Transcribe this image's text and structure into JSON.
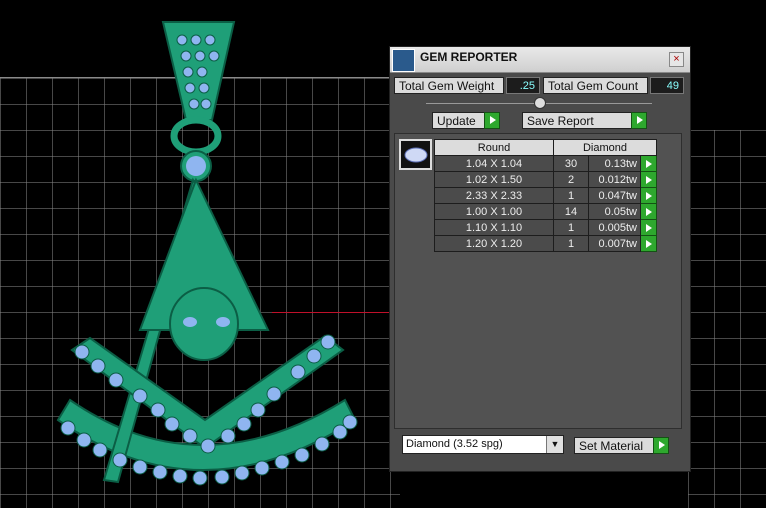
{
  "window": {
    "title": "GEM REPORTER",
    "close_glyph": "×"
  },
  "summary": {
    "weight_label": "Total Gem Weight",
    "weight_value": ".25",
    "count_label": "Total Gem Count",
    "count_value": "49"
  },
  "buttons": {
    "update": "Update",
    "save_report": "Save Report",
    "set_material": "Set Material"
  },
  "gem_table": {
    "headers": [
      "Round",
      "Diamond"
    ],
    "rows": [
      {
        "size": "1.04 X 1.04",
        "count": "30",
        "weight": "0.13tw"
      },
      {
        "size": "1.02 X 1.50",
        "count": "2",
        "weight": "0.012tw"
      },
      {
        "size": "2.33 X 2.33",
        "count": "1",
        "weight": "0.047tw"
      },
      {
        "size": "1.00 X 1.00",
        "count": "14",
        "weight": "0.05tw"
      },
      {
        "size": "1.10 X 1.10",
        "count": "1",
        "weight": "0.005tw"
      },
      {
        "size": "1.20 X 1.20",
        "count": "1",
        "weight": "0.007tw"
      }
    ]
  },
  "material": {
    "selected": "Diamond      (3.52 spg)",
    "dropdown_glyph": "▼"
  },
  "colors": {
    "model": "#1f9f78",
    "gems": "#8fb5f0",
    "accent_green": "#2ea82e",
    "axis_red": "#c0102a"
  },
  "icons": {
    "app": "gem-reporter-app-icon",
    "gem_preview": "round-gem-icon"
  }
}
